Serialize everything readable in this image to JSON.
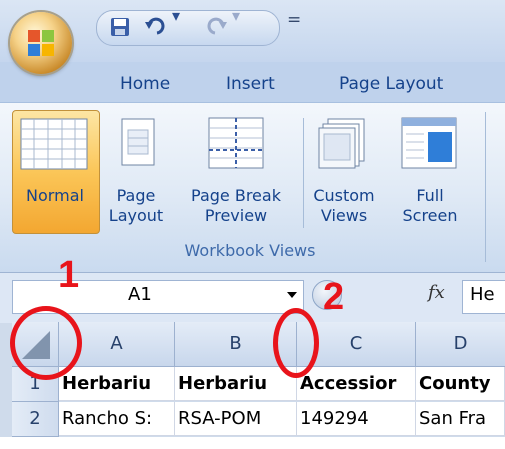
{
  "quick_access": {
    "save_icon": "save-icon",
    "undo_icon": "undo-icon",
    "redo_icon": "redo-icon",
    "dropdown_glyph": "▾",
    "customize_glyph": "="
  },
  "tabs": [
    {
      "label": "Home"
    },
    {
      "label": "Insert"
    },
    {
      "label": "Page Layout"
    }
  ],
  "ribbon": {
    "buttons": [
      {
        "line1": "Normal",
        "line2": ""
      },
      {
        "line1": "Page",
        "line2": "Layout"
      },
      {
        "line1": "Page Break",
        "line2": "Preview"
      },
      {
        "line1": "Custom",
        "line2": "Views"
      },
      {
        "line1": "Full",
        "line2": "Screen"
      }
    ],
    "group_label": "Workbook Views"
  },
  "formula_bar": {
    "name_box": "A1",
    "fx": "fx",
    "content": "He"
  },
  "sheet": {
    "columns": [
      "A",
      "B",
      "C",
      "D"
    ],
    "rows": [
      {
        "num": "1",
        "cells": [
          "Herbariu",
          "Herbariu",
          "Accessior",
          "County"
        ]
      },
      {
        "num": "2",
        "cells": [
          "Rancho S:",
          "RSA-POM",
          "149294",
          "San Fra"
        ]
      }
    ]
  },
  "annotations": [
    {
      "label": "1"
    },
    {
      "label": "2"
    }
  ],
  "colors": {
    "annotation": "#e8141b",
    "selected_button": "#fbc658",
    "ribbon_text": "#15428b"
  }
}
